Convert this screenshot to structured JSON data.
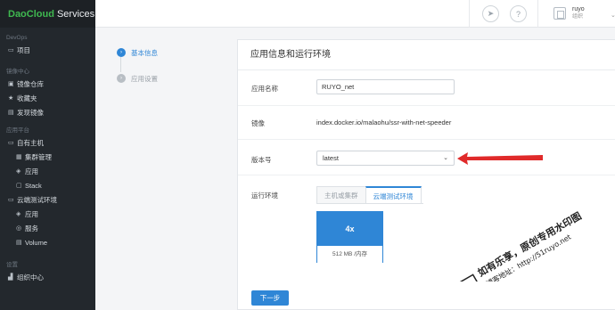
{
  "brand": {
    "name": "DaoCloud",
    "suffix": "Services"
  },
  "sidebar": {
    "sections": [
      {
        "title": "DevOps",
        "items": [
          {
            "label": "项目",
            "icon": "folder-icon",
            "glyph": "▭"
          }
        ]
      },
      {
        "title": "镜像中心",
        "items": [
          {
            "label": "镜像仓库",
            "icon": "image-repo-icon",
            "glyph": "▣"
          },
          {
            "label": "收藏夹",
            "icon": "star-icon",
            "glyph": "★"
          },
          {
            "label": "发现镜像",
            "icon": "discover-icon",
            "glyph": "▤"
          }
        ]
      },
      {
        "title": "应用平台",
        "items": [
          {
            "label": "自有主机",
            "icon": "host-icon",
            "glyph": "▭",
            "group": true
          },
          {
            "label": "集群管理",
            "icon": "cluster-icon",
            "glyph": "▦",
            "sub": true
          },
          {
            "label": "应用",
            "icon": "app-icon",
            "glyph": "◈",
            "sub": true
          },
          {
            "label": "Stack",
            "icon": "stack-icon",
            "glyph": "▢",
            "sub": true
          },
          {
            "label": "云端测试环境",
            "icon": "cloud-icon",
            "glyph": "▭",
            "group": true
          },
          {
            "label": "应用",
            "icon": "app-icon",
            "glyph": "◈",
            "sub": true
          },
          {
            "label": "服务",
            "icon": "service-icon",
            "glyph": "◎",
            "sub": true
          },
          {
            "label": "Volume",
            "icon": "volume-icon",
            "glyph": "▤",
            "sub": true
          }
        ]
      },
      {
        "title": "设置",
        "items": [
          {
            "label": "组织中心",
            "icon": "org-center-icon",
            "glyph": "▟"
          }
        ]
      }
    ]
  },
  "topbar": {
    "org_name": "ruyo",
    "org_sub": "组织",
    "rocket_glyph": "➤",
    "help_glyph": "?"
  },
  "steps": [
    {
      "label": "基本信息",
      "active": true
    },
    {
      "label": "应用设置",
      "active": false
    }
  ],
  "form": {
    "title": "应用信息和运行环境",
    "app_name_label": "应用名称",
    "app_name_value": "RUYO_net",
    "image_label": "镜像",
    "image_value": "index.docker.io/malaohu/ssr-with-net-speeder",
    "version_label": "版本号",
    "version_value": "latest",
    "env_label": "运行环境",
    "tabs": [
      "主机或集群",
      "云端测试环境"
    ],
    "active_tab": 1,
    "env_card": {
      "size": "4x",
      "spec": "512 MB /内存"
    },
    "next_label": "下一步"
  },
  "watermark": {
    "line1": "如有乐享，原创专用水印图",
    "line2": "博客地址：http://51ruyo.net"
  },
  "colors": {
    "accent": "#2f86d6",
    "sidebar": "#23282d",
    "brand_green": "#3fb950",
    "arrow_red": "#e02a2a"
  }
}
